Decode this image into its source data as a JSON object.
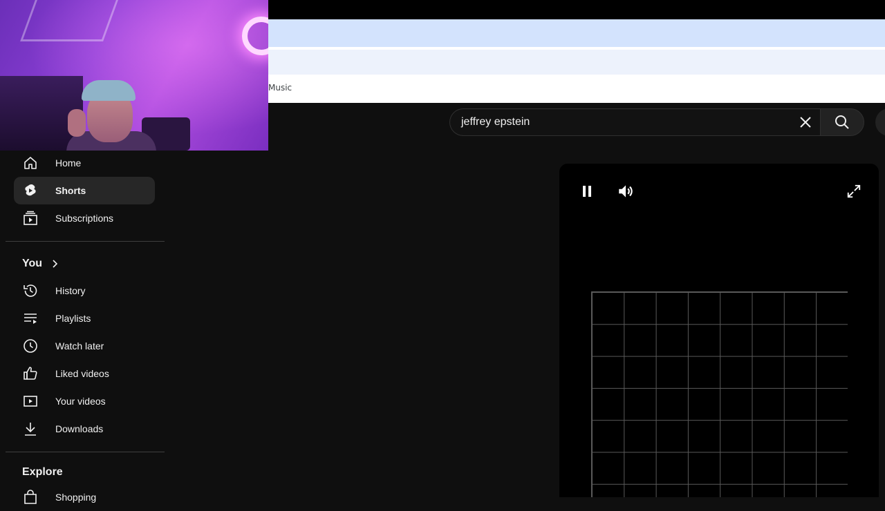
{
  "browser": {
    "bookmarks": [
      "Music"
    ]
  },
  "search": {
    "query": "jeffrey epstein"
  },
  "sidebar": {
    "main": [
      {
        "label": "Home",
        "icon": "home-icon"
      },
      {
        "label": "Shorts",
        "icon": "shorts-icon",
        "active": true
      },
      {
        "label": "Subscriptions",
        "icon": "subscriptions-icon"
      }
    ],
    "you": {
      "title": "You",
      "items": [
        {
          "label": "History",
          "icon": "history-icon"
        },
        {
          "label": "Playlists",
          "icon": "playlists-icon"
        },
        {
          "label": "Watch later",
          "icon": "watch-later-icon"
        },
        {
          "label": "Liked videos",
          "icon": "like-icon"
        },
        {
          "label": "Your videos",
          "icon": "your-videos-icon"
        },
        {
          "label": "Downloads",
          "icon": "download-icon"
        }
      ]
    },
    "explore": {
      "title": "Explore",
      "items": [
        {
          "label": "Shopping",
          "icon": "shopping-icon"
        }
      ]
    }
  },
  "player": {
    "state": "playing",
    "controls": [
      "pause-icon",
      "volume-icon",
      "fullscreen-icon"
    ]
  },
  "colors": {
    "background": "#0f0f0f",
    "active_item": "#272727",
    "tab_bar": "#d3e3fd",
    "address_bar": "#edf2fc"
  }
}
